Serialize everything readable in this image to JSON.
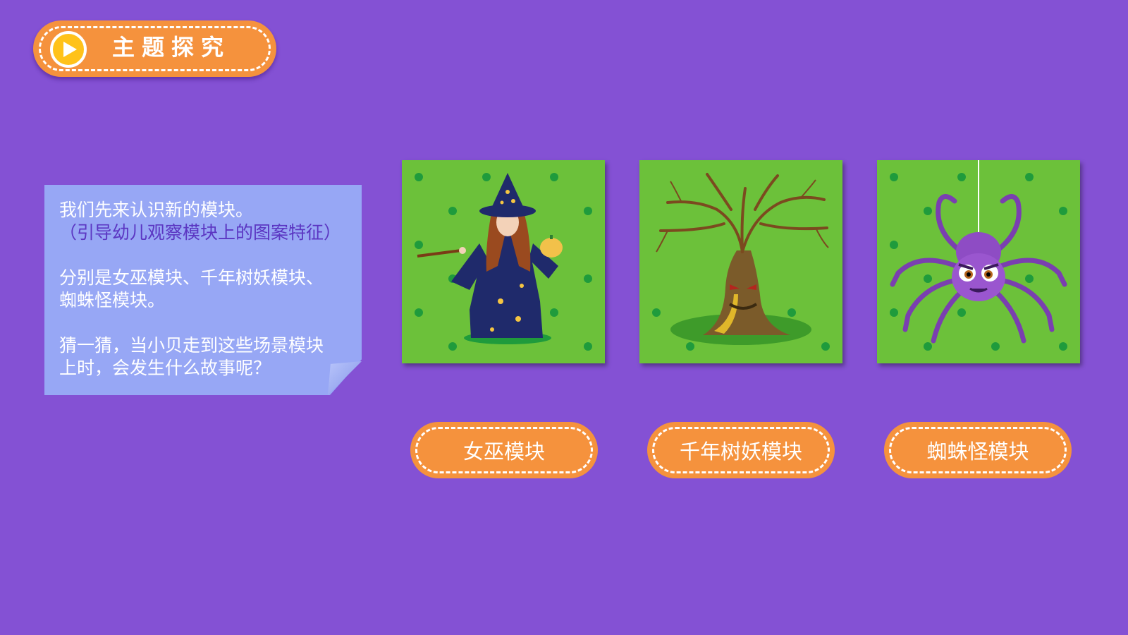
{
  "header": {
    "title": "主题探究",
    "icon": "play-icon"
  },
  "note": {
    "line1": "我们先来认识新的模块。",
    "line2": "（引导幼儿观察模块上的图案特征）",
    "line3": "分别是女巫模块、千年树妖模块、",
    "line4": "蜘蛛怪模块。",
    "line5": "猜一猜，当小贝走到这些场景模块",
    "line6": "上时，会发生什么故事呢？"
  },
  "cards": [
    {
      "label": "女巫模块",
      "icon": "witch-illustration"
    },
    {
      "label": "千年树妖模块",
      "icon": "tree-monster-illustration"
    },
    {
      "label": "蜘蛛怪模块",
      "icon": "spider-illustration"
    }
  ],
  "colors": {
    "background": "#8451d4",
    "accent": "#f5923d",
    "card_green": "#6cc13a",
    "note_blue": "#97a7f5"
  }
}
